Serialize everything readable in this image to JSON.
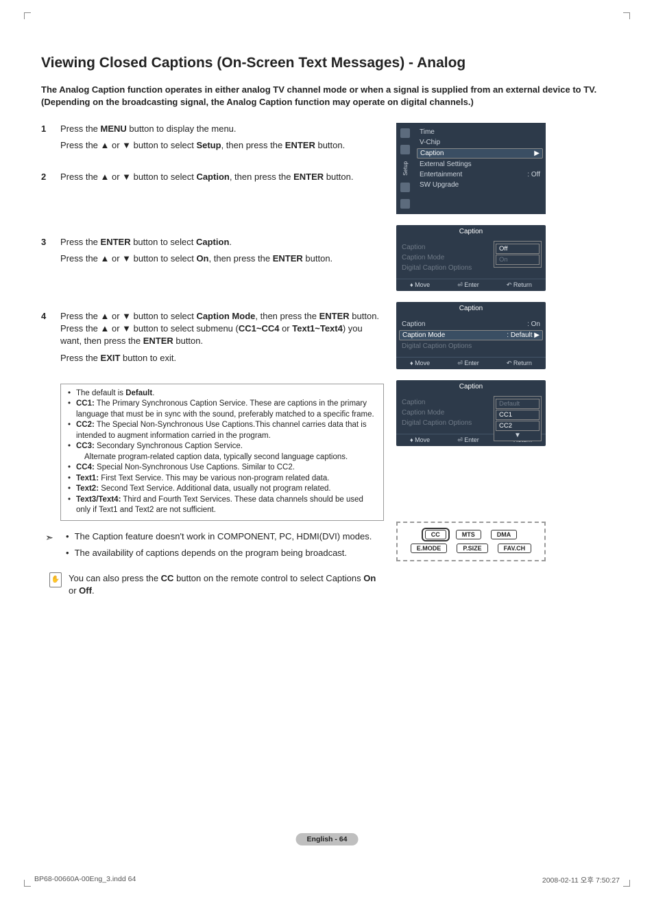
{
  "title": "Viewing Closed Captions (On-Screen Text Messages) - Analog",
  "intro": "The Analog Caption function operates in either analog TV channel mode or when a signal is supplied from an external device to TV. (Depending on the broadcasting signal, the Analog Caption function may operate on digital channels.)",
  "steps": {
    "s1": {
      "num": "1",
      "l1a": "Press the ",
      "l1b": "MENU",
      "l1c": " button to display the menu.",
      "l2a": "Press the ▲ or ▼ button to select ",
      "l2b": "Setup",
      "l2c": ", then press the ",
      "l2d": "ENTER",
      "l2e": " button."
    },
    "s2": {
      "num": "2",
      "l1a": "Press the ▲ or ▼ button to select ",
      "l1b": "Caption",
      "l1c": ", then press the ",
      "l1d": "ENTER",
      "l1e": " button."
    },
    "s3": {
      "num": "3",
      "l1a": "Press the ",
      "l1b": "ENTER",
      "l1c": " button to select ",
      "l1d": "Caption",
      "l1e": ".",
      "l2a": "Press the ▲ or ▼ button to select ",
      "l2b": "On",
      "l2c": ", then press the ",
      "l2d": "ENTER",
      "l2e": " button."
    },
    "s4": {
      "num": "4",
      "l1a": "Press the ▲ or ▼ button to select ",
      "l1b": "Caption Mode",
      "l1c": ", then press the ",
      "l1d": "ENTER",
      "l1e": " button. Press the ▲ or ▼ button to select submenu (",
      "l1f": "CC1~CC4",
      "l1g": " or ",
      "l1h": "Text1~Text4",
      "l1i": ") you want, then press the ",
      "l1j": "ENTER",
      "l1k": " button.",
      "l2a": "Press the ",
      "l2b": "EXIT",
      "l2c": " button to exit."
    }
  },
  "bullets": {
    "b0a": "The default is ",
    "b0b": "Default",
    "b0c": ".",
    "b1a": "CC1:",
    "b1b": " The Primary Synchronous Caption Service. These are captions in the primary language that must be in sync with the sound, preferably matched to a specific frame.",
    "b2a": "CC2:",
    "b2b": " The Special Non-Synchronous Use Captions.This channel carries data that is intended to augment information carried in the program.",
    "b3a": "CC3:",
    "b3b": " Secondary Synchronous Caption Service.",
    "b3c": "Alternate program-related caption data, typically second language captions.",
    "b4a": "CC4:",
    "b4b": " Special Non-Synchronous Use Captions. Similar to CC2.",
    "b5a": "Text1:",
    "b5b": " First Text Service. This may be various non-program related data.",
    "b6a": "Text2:",
    "b6b": " Second Text Service. Additional data, usually not program related.",
    "b7a": "Text3/Text4:",
    "b7b": " Third and Fourth Text Services. These data channels should be used only if Text1 and Text2 are not sufficient."
  },
  "notes": {
    "n1": "The Caption feature doesn't work in COMPONENT, PC, HDMI(DVI) modes.",
    "n2": "The availability of captions depends on the program being broadcast."
  },
  "remote_tip": {
    "a": "You can also press the ",
    "b": "CC",
    "c": " button on the remote control to select Captions ",
    "d": "On",
    "e": " or ",
    "f": "Off",
    "g": "."
  },
  "osd1": {
    "side_label": "Setup",
    "items": {
      "i0": "Time",
      "i1": "V-Chip",
      "i2": "Caption",
      "i3": "External Settings",
      "i4": "Entertainment",
      "i4v": ": Off",
      "i5": "SW Upgrade"
    }
  },
  "osd2": {
    "title": "Caption",
    "r1": "Caption",
    "r2": "Caption Mode",
    "r3": "Digital Caption Options",
    "opt1": "Off",
    "opt2": "On",
    "foot_move": "Move",
    "foot_enter": "Enter",
    "foot_return": "Return"
  },
  "osd3": {
    "title": "Caption",
    "r1": "Caption",
    "r1v": ": On",
    "r2": "Caption Mode",
    "r2v": ": Default",
    "r3": "Digital Caption Options",
    "foot_move": "Move",
    "foot_enter": "Enter",
    "foot_return": "Return"
  },
  "osd4": {
    "title": "Caption",
    "r1": "Caption",
    "r2": "Caption Mode",
    "r3": "Digital Caption Options",
    "opt1": "Default",
    "opt2": "CC1",
    "opt3": "CC2",
    "foot_move": "Move",
    "foot_enter": "Enter",
    "foot_return": "Return"
  },
  "remote_buttons": {
    "b1": "CC",
    "b2": "MTS",
    "b3": "DMA",
    "b4": "E.MODE",
    "b5": "P.SIZE",
    "b6": "FAV.CH"
  },
  "page_chip": "English - 64",
  "footer_left": "BP68-00660A-00Eng_3.indd   64",
  "footer_right": "2008-02-11   오후 7:50:27"
}
